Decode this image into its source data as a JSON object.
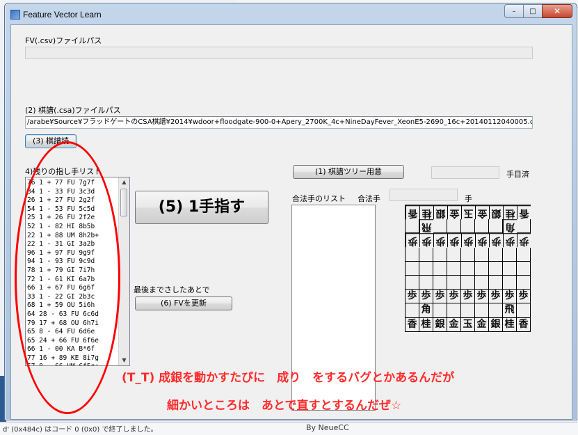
{
  "window": {
    "title": "Feature Vector Learn",
    "min_glyph": "–",
    "max_glyph": "□",
    "close_glyph": "✕"
  },
  "background": {
    "bottom_text": "d' (0x484c) はコード 0 (0x0) で終了しました。",
    "bottom_right_text": "By NeueCC"
  },
  "fv": {
    "label": "FV(.csv)ファイルパス",
    "path": ""
  },
  "kifu": {
    "label": "(2) 棋譜(.csa)ファイルパス",
    "path": "/arabe¥Source¥フラッドゲートのCSA棋譜¥2014¥wdoor+floodgate-900-0+Apery_2700K_4c+NineDayFever_XeonE5-2690_16c+20140112040005.csa",
    "read_button": "(3) 棋譜読"
  },
  "moves": {
    "label": "4)残りの指し手リスト",
    "items": [
      "76 1 + 77 FU 7g7f",
      "34 1 - 33 FU 3c3d",
      "26 1 + 27 FU 2g2f",
      "54 1 - 53 FU 5c5d",
      "25 1 + 26 FU 2f2e",
      "52 1 - 82 HI 8b5b",
      "22 1 + 88 UM 8h2b+",
      "22 1 - 31 GI 3a2b",
      "96 1 + 97 FU 9g9f",
      "94 1 - 93 FU 9c9d",
      "78 1 + 79 GI 7i7h",
      "72 1 - 61 KI 6a7b",
      "66 1 + 67 FU 6g6f",
      "33 1 - 22 GI 2b3c",
      "68 1 + 59 OU 5i6h",
      "64 28 - 63 FU 6c6d",
      "79 17 + 68 OU 6h7i",
      "65 8 - 64 FU 6d6e",
      "65 24 + 66 FU 6f6e",
      "66 1 - 00 KA B*6f",
      "77 16 + 89 KE 8i7g",
      "57 8 - 66 UM 6f5g+"
    ]
  },
  "play_button": "(5) 1手指す",
  "after_label": "最後までさしたあとで",
  "update_button": "(6) FVを更新",
  "tree": {
    "button": "(1) 棋譜ツリー用意",
    "moves_done_value": "",
    "moves_done_suffix": "手目済"
  },
  "legal": {
    "list_label": "合法手のリスト",
    "move_label": "合法手",
    "move_value": "",
    "move_suffix": "手"
  },
  "board": [
    [
      "香",
      "桂",
      "銀",
      "金",
      "玉",
      "金",
      "銀",
      "桂",
      "香"
    ],
    [
      "",
      "飛",
      "",
      "",
      "",
      "",
      "",
      "角",
      ""
    ],
    [
      "歩",
      "歩",
      "歩",
      "歩",
      "歩",
      "歩",
      "歩",
      "歩",
      "歩"
    ],
    [
      "",
      "",
      "",
      "",
      "",
      "",
      "",
      "",
      ""
    ],
    [
      "",
      "",
      "",
      "",
      "",
      "",
      "",
      "",
      ""
    ],
    [
      "",
      "",
      "",
      "",
      "",
      "",
      "",
      "",
      ""
    ],
    [
      "歩",
      "歩",
      "歩",
      "歩",
      "歩",
      "歩",
      "歩",
      "歩",
      "歩"
    ],
    [
      "",
      "角",
      "",
      "",
      "",
      "",
      "",
      "飛",
      ""
    ],
    [
      "香",
      "桂",
      "銀",
      "金",
      "玉",
      "金",
      "銀",
      "桂",
      "香"
    ]
  ],
  "annotation": {
    "line1": "(T_T) 成銀を動かすたびに　成り　をするバグとかあるんだが",
    "line2": "細かいところは　あとで直すとするんだぜ☆"
  }
}
